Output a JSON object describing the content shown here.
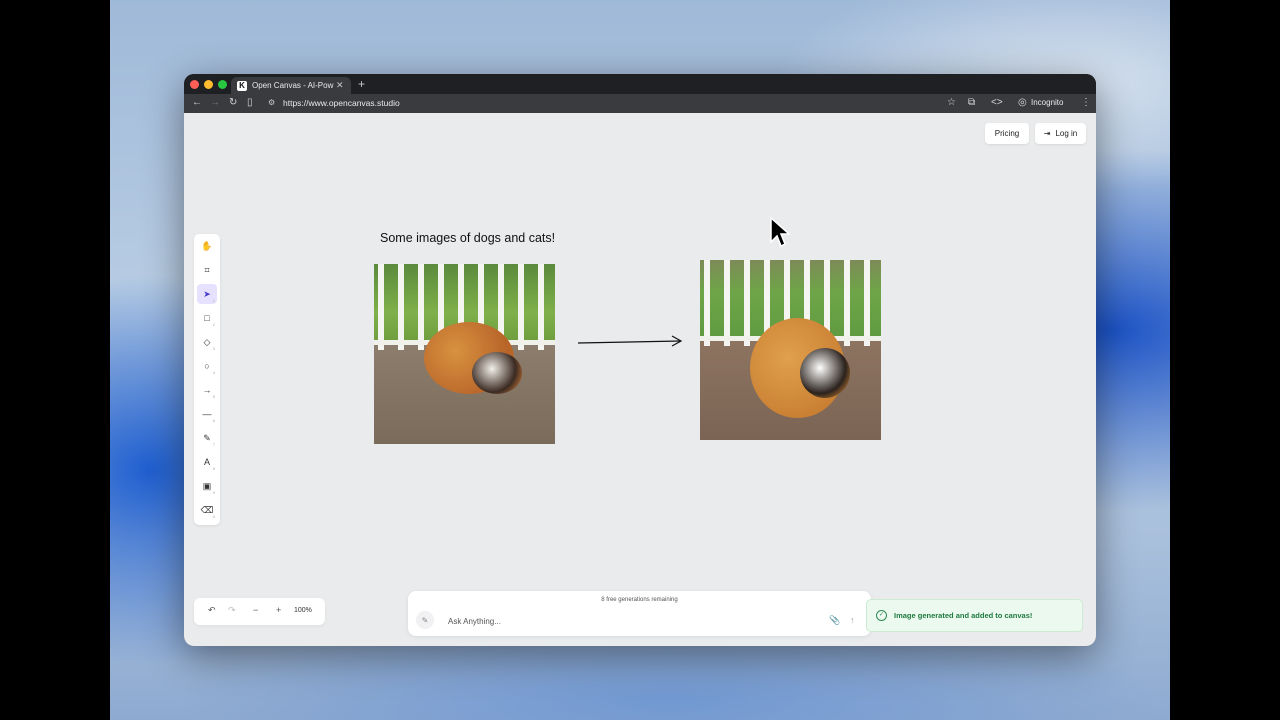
{
  "browser": {
    "tab_title": "Open Canvas - AI-Pow",
    "tab_favicon": "K",
    "url": "https://www.opencanvas.studio",
    "incognito_label": "Incognito"
  },
  "header": {
    "pricing_label": "Pricing",
    "login_label": "Log in"
  },
  "canvas": {
    "title": "Some images of dogs and cats!"
  },
  "toolbar": {
    "tools": [
      {
        "name": "hand-tool",
        "icon": "hand-icon",
        "glyph": "✋",
        "key": ""
      },
      {
        "name": "frame-tool",
        "icon": "crop-icon",
        "glyph": "⌗",
        "key": ""
      },
      {
        "name": "select-tool",
        "icon": "cursor-icon",
        "glyph": "➤",
        "key": "1"
      },
      {
        "name": "rectangle-tool",
        "icon": "square-icon",
        "glyph": "□",
        "key": "2"
      },
      {
        "name": "diamond-tool",
        "icon": "diamond-icon",
        "glyph": "◇",
        "key": "3"
      },
      {
        "name": "ellipse-tool",
        "icon": "circle-icon",
        "glyph": "○",
        "key": "4"
      },
      {
        "name": "arrow-tool",
        "icon": "arrow-icon",
        "glyph": "→",
        "key": "5"
      },
      {
        "name": "line-tool",
        "icon": "line-icon",
        "glyph": "—",
        "key": "6"
      },
      {
        "name": "pencil-tool",
        "icon": "pencil-icon",
        "glyph": "✎",
        "key": "7"
      },
      {
        "name": "text-tool",
        "icon": "text-icon",
        "glyph": "A",
        "key": "8"
      },
      {
        "name": "image-tool",
        "icon": "image-icon",
        "glyph": "▣",
        "key": "9"
      },
      {
        "name": "eraser-tool",
        "icon": "eraser-icon",
        "glyph": "⌫",
        "key": "0"
      }
    ]
  },
  "zoom": {
    "level": "100%"
  },
  "prompt": {
    "remaining_text": "8 free generations remaining",
    "placeholder": "Ask Anything..."
  },
  "toast": {
    "message": "Image generated and added to canvas!"
  }
}
